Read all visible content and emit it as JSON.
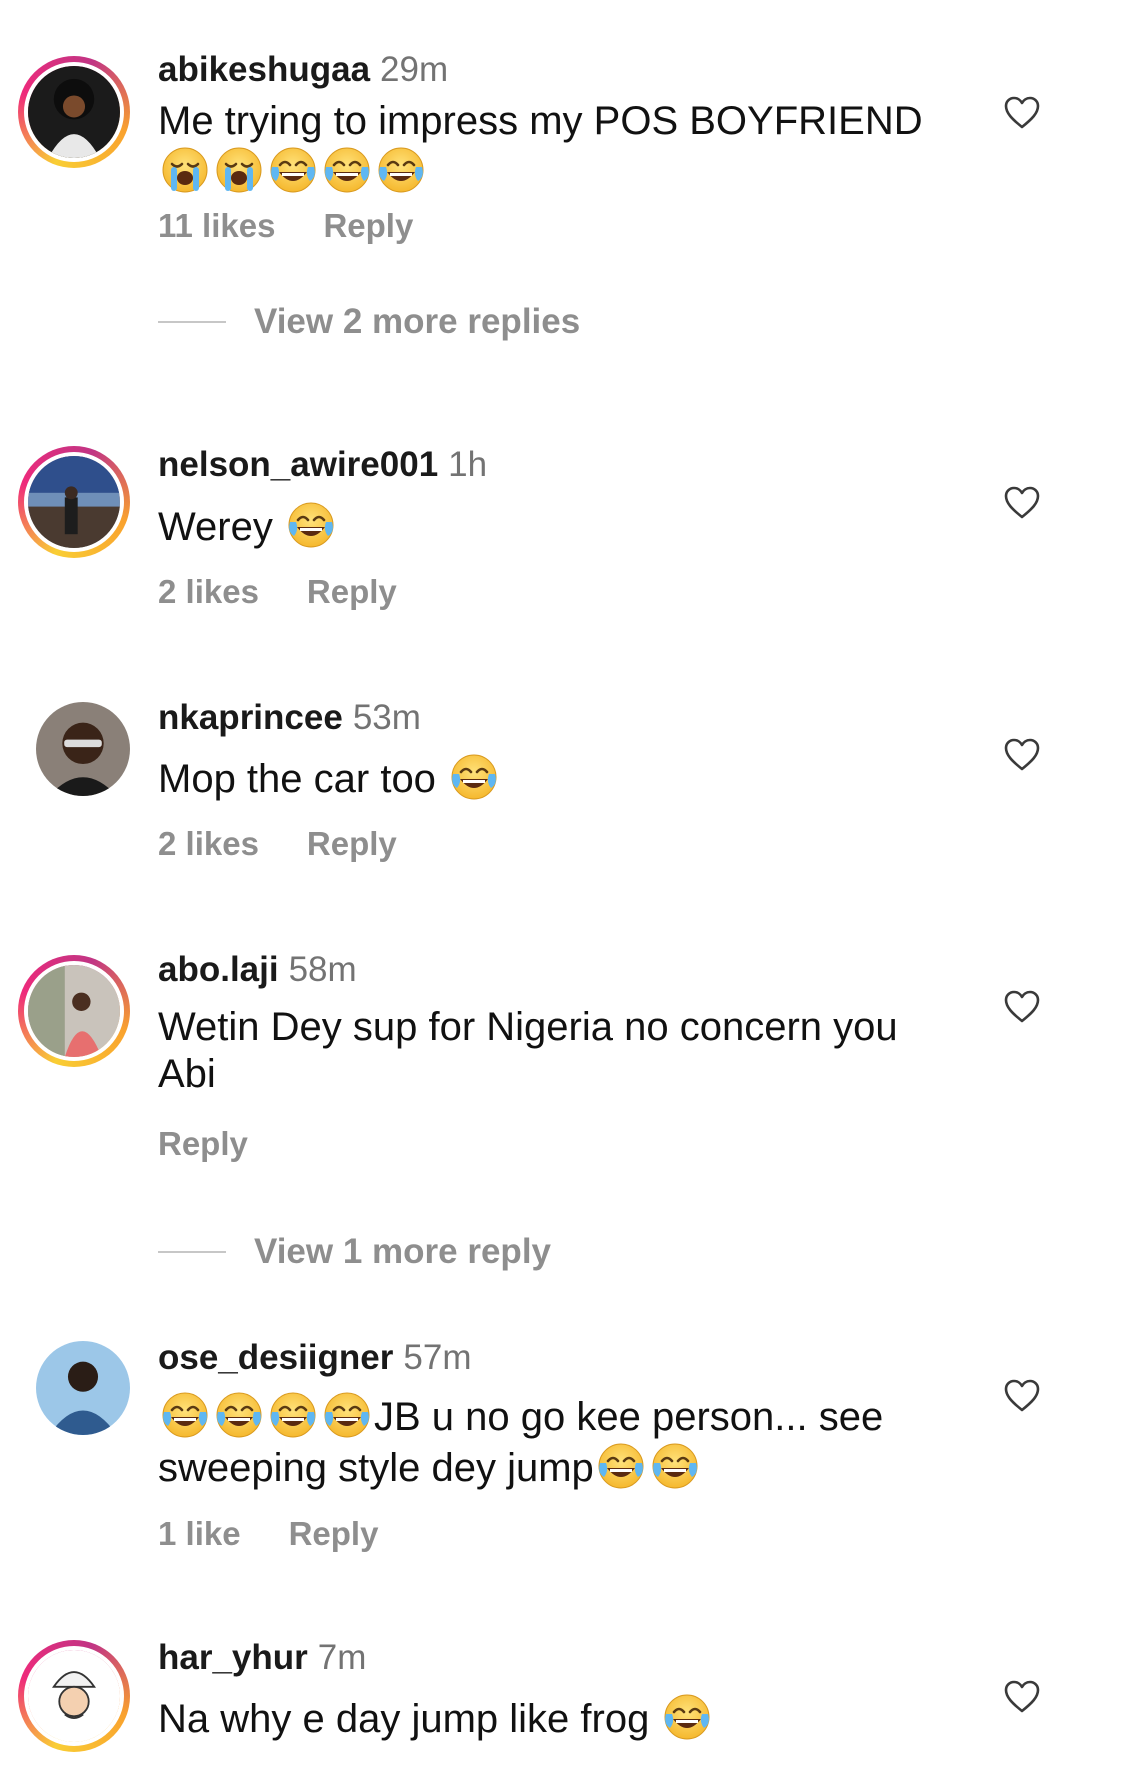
{
  "comments": [
    {
      "username": "abikeshugaa",
      "time": "29m",
      "text": "Me trying to impress my POS BOYFRIEND",
      "emojis": [
        "loudly-crying-face-emoji",
        "loudly-crying-face-emoji",
        "tears-of-joy-emoji",
        "tears-of-joy-emoji",
        "tears-of-joy-emoji"
      ],
      "likes": "11 likes",
      "reply": "Reply",
      "view_more": "View 2 more replies"
    },
    {
      "username": "nelson_awire001",
      "time": "1h",
      "text": "Werey",
      "emojis": [
        "tears-of-joy-emoji"
      ],
      "likes": "2 likes",
      "reply": "Reply"
    },
    {
      "username": "nkaprincee",
      "time": "53m",
      "text": "Mop the car too",
      "emojis": [
        "tears-of-joy-emoji"
      ],
      "likes": "2 likes",
      "reply": "Reply"
    },
    {
      "username": "abo.laji",
      "time": "58m",
      "text": "Wetin Dey sup for Nigeria no concern you Abi",
      "reply": "Reply",
      "view_more": "View 1 more reply"
    },
    {
      "username": "ose_desiigner",
      "time": "57m",
      "text_a": "JB u no go kee person... see sweeping style dey jump",
      "emojis_lead": [
        "tears-of-joy-emoji",
        "tears-of-joy-emoji",
        "tears-of-joy-emoji",
        "tears-of-joy-emoji"
      ],
      "emojis_trail": [
        "tears-of-joy-emoji",
        "tears-of-joy-emoji"
      ],
      "likes": "1 like",
      "reply": "Reply"
    },
    {
      "username": "har_yhur",
      "time": "7m",
      "text": "Na why e day jump like frog",
      "emojis": [
        "tears-of-joy-emoji"
      ]
    }
  ],
  "icons": {
    "like": "heart-outline-icon"
  },
  "colors": {
    "secondary_text": "#8e8e8e",
    "story_ring": [
      "#f9ce34",
      "#ee2a7b",
      "#c13584"
    ]
  }
}
